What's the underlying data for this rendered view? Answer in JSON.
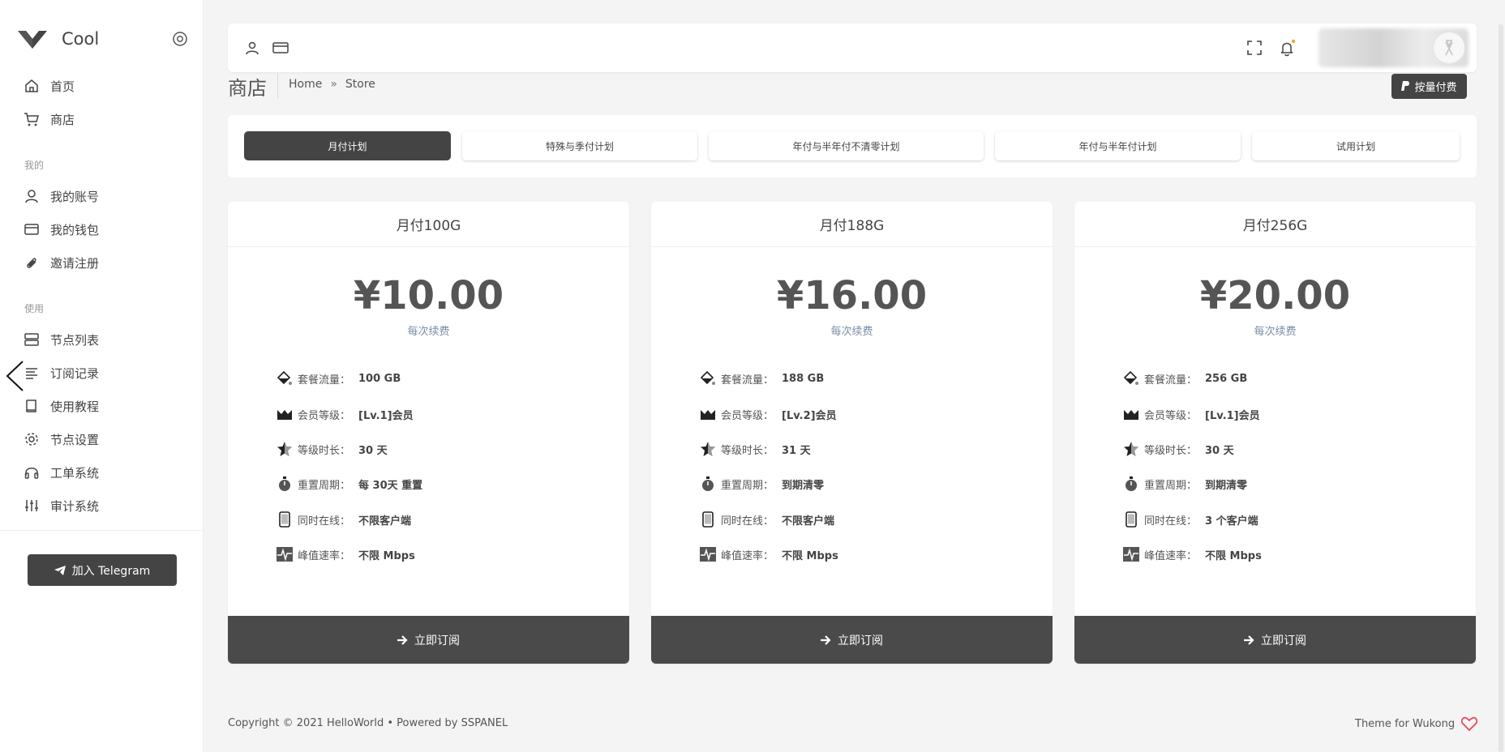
{
  "app": {
    "name": "Cool"
  },
  "sidebar": {
    "items_main": [
      {
        "label": "首页",
        "icon": "home-icon"
      },
      {
        "label": "商店",
        "icon": "cart-icon"
      }
    ],
    "section_mine": "我的",
    "items_mine": [
      {
        "label": "我的账号",
        "icon": "user-icon"
      },
      {
        "label": "我的钱包",
        "icon": "wallet-icon"
      },
      {
        "label": "邀请注册",
        "icon": "paperclip-icon"
      }
    ],
    "section_use": "使用",
    "items_use": [
      {
        "label": "节点列表",
        "icon": "server-icon"
      },
      {
        "label": "订阅记录",
        "icon": "list-icon"
      },
      {
        "label": "使用教程",
        "icon": "book-icon"
      },
      {
        "label": "节点设置",
        "icon": "gear-icon"
      },
      {
        "label": "工单系统",
        "icon": "headphones-icon"
      },
      {
        "label": "审计系统",
        "icon": "sliders-icon"
      }
    ],
    "telegram_button": "加入 Telegram"
  },
  "header": {
    "title": "商店",
    "breadcrumb": {
      "home": "Home",
      "separator": "»",
      "current": "Store"
    },
    "pay_button": "按量付费"
  },
  "tabs": [
    {
      "label": "月付计划",
      "active": true
    },
    {
      "label": "特殊与季付计划",
      "active": false
    },
    {
      "label": "年付与半年付不清零计划",
      "active": false
    },
    {
      "label": "年付与半年付计划",
      "active": false
    },
    {
      "label": "试用计划",
      "active": false
    }
  ],
  "plans": [
    {
      "title": "月付100G",
      "price": "¥10.00",
      "price_note": "每次续费",
      "features": [
        {
          "key": "套餐流量：",
          "value": "100 GB"
        },
        {
          "key": "会员等级：",
          "value": "[Lv.1]会员"
        },
        {
          "key": "等级时长：",
          "value": "30 天"
        },
        {
          "key": "重置周期：",
          "value": "每 30天 重置"
        },
        {
          "key": "同时在线：",
          "value": "不限客户端"
        },
        {
          "key": "峰值速率：",
          "value": "不限 Mbps"
        }
      ],
      "button": "立即订阅"
    },
    {
      "title": "月付188G",
      "price": "¥16.00",
      "price_note": "每次续费",
      "features": [
        {
          "key": "套餐流量：",
          "value": "188 GB"
        },
        {
          "key": "会员等级：",
          "value": "[Lv.2]会员"
        },
        {
          "key": "等级时长：",
          "value": "31 天"
        },
        {
          "key": "重置周期：",
          "value": "到期清零"
        },
        {
          "key": "同时在线：",
          "value": "不限客户端"
        },
        {
          "key": "峰值速率：",
          "value": "不限 Mbps"
        }
      ],
      "button": "立即订阅"
    },
    {
      "title": "月付256G",
      "price": "¥20.00",
      "price_note": "每次续费",
      "features": [
        {
          "key": "套餐流量：",
          "value": "256 GB"
        },
        {
          "key": "会员等级：",
          "value": "[Lv.1]会员"
        },
        {
          "key": "等级时长：",
          "value": "30 天"
        },
        {
          "key": "重置周期：",
          "value": "到期清零"
        },
        {
          "key": "同时在线：",
          "value": "3 个客户端"
        },
        {
          "key": "峰值速率：",
          "value": "不限 Mbps"
        }
      ],
      "button": "立即订阅"
    }
  ],
  "footer": {
    "copyright": "Copyright © 2021 HelloWorld • Powered by  SSPANEL",
    "theme": "Theme for Wukong"
  },
  "colors": {
    "dark": "#444444",
    "background": "#f4f4f4",
    "accent_heart": "#e2485b",
    "notify_dot": "#f5a623"
  }
}
